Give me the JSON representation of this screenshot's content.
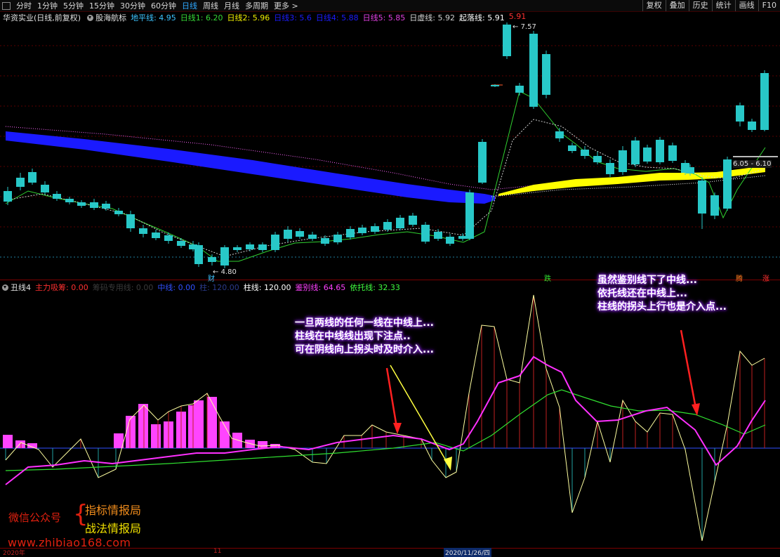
{
  "toolbar": {
    "periods": [
      "分时",
      "1分钟",
      "5分钟",
      "15分钟",
      "30分钟",
      "60分钟",
      "日线",
      "周线",
      "月线",
      "多周期",
      "更多 >"
    ],
    "active_period": "日线",
    "right_buttons": [
      "复权",
      "叠加",
      "历史",
      "统计",
      "画线",
      "F10"
    ]
  },
  "main_info": {
    "stock_name": "华资实业(日线,前复权)",
    "indicator_name": "股海航标",
    "items": [
      {
        "label": "地平线: 4.95",
        "color": "#3cc3ff"
      },
      {
        "label": "日线1: 6.20",
        "color": "#36d836"
      },
      {
        "label": "日线2: 5.96",
        "color": "#f0f000"
      },
      {
        "label": "日线3: 5.6",
        "color": "#1c1cff"
      },
      {
        "label": "日线4: 5.88",
        "color": "#1c1cff"
      },
      {
        "label": "日线5: 5.85",
        "color": "#e040e0"
      },
      {
        "label": "日虚线: 5.92",
        "color": "#d0d0d0"
      },
      {
        "label": "起落线: 5.91",
        "color": "#ffffff"
      },
      {
        "label": "5.91",
        "color": "#ff3030"
      }
    ]
  },
  "sub_info": {
    "indicator_name": "丑线4",
    "items": [
      {
        "label": "主力吸筹: 0.00",
        "color": "#ff3030"
      },
      {
        "label": "筹码专用线: 0.00",
        "color": "#3a3a3a"
      },
      {
        "label": "中线: 0.00",
        "color": "#3050ff"
      },
      {
        "label": "柱: 120.00",
        "color": "#2a3a8a"
      },
      {
        "label": "柱线: 120.00",
        "color": "#ffffff"
      },
      {
        "label": "鉴别线: 64.65",
        "color": "#ff40ff"
      },
      {
        "label": "依托线: 32.33",
        "color": "#40ff40"
      }
    ]
  },
  "price_labels": {
    "high": "7.57",
    "low": "4.80",
    "range": "6.05 - 6.10"
  },
  "markers": {
    "cai": "财",
    "die": "跌",
    "teng": "腾",
    "zhang": "涨"
  },
  "annotations": {
    "left": [
      "一旦两线的任何一线在中线上...",
      "柱线在中线线出现下注点..",
      "可在阴线向上拐头时及时介入..."
    ],
    "right": [
      "虽然鉴别线下了中线...",
      "依托线还在中线上...",
      "柱线的拐头上行也是介入点..."
    ]
  },
  "watermark": {
    "label": "微信公众号",
    "line1": "指标情报局",
    "line2": "战法情报局",
    "url": "www.zhibiao168.com"
  },
  "axis": {
    "left_date": "2020年",
    "mid_label": "11",
    "cursor_date": "2020/11/26/四"
  },
  "colors": {
    "up": "#ff3c3c",
    "up_big": "#ff7a20",
    "down": "#28c8c8",
    "blue_band": "#1a1aff",
    "yellow_band": "#ffff00",
    "magenta": "#ff30ff",
    "green": "#30e030",
    "yellow_line": "#ffffa0",
    "pink_bar": "#ff44ff",
    "midline": "#3050ff"
  }
}
